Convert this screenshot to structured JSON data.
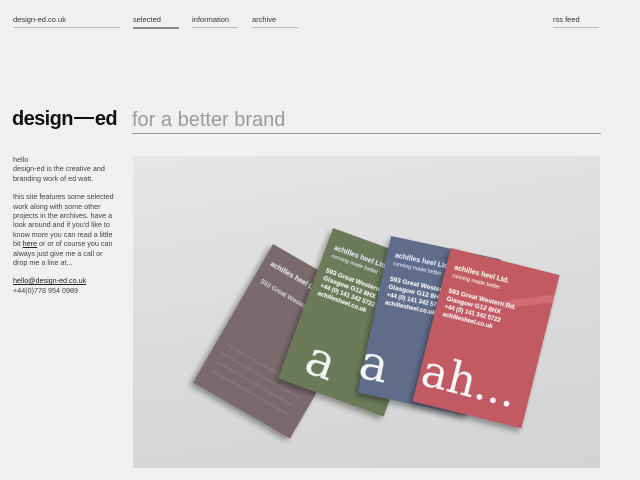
{
  "nav": {
    "site_url": "design-ed.co.uk",
    "items": [
      {
        "label": "selected"
      },
      {
        "label": "information"
      },
      {
        "label": "archive"
      }
    ],
    "rss": "rss feed"
  },
  "header": {
    "logo_left": "design",
    "logo_right": "ed",
    "tagline": "for a better brand"
  },
  "sidebar": {
    "greeting": "hello",
    "intro": "design-ed is the creative and branding work of ed watt.",
    "body_before_link": "this site features some selected work along with some other projects in the archives. have a look around and if you'd like to know more you can read a little bit ",
    "body_link": "here",
    "body_after_link": " or or of course you can always just give me a call or drop me a line at...",
    "email": "hello@design-ed.co.uk",
    "phone": "+44(0)778 954 0989"
  },
  "cards": {
    "company": "achilles heel Ltd.",
    "tagline": "running made better",
    "address1": "593 Great Western Rd.",
    "address2": "Glasgow G12 8HX",
    "phone": "+44 (0) 141 342 5722",
    "web": "achillesheel.co.uk",
    "big_text": "ah...",
    "colors": [
      "#7a6a6e",
      "#6c7a5a",
      "#5f6c8a",
      "#c25a63"
    ]
  }
}
